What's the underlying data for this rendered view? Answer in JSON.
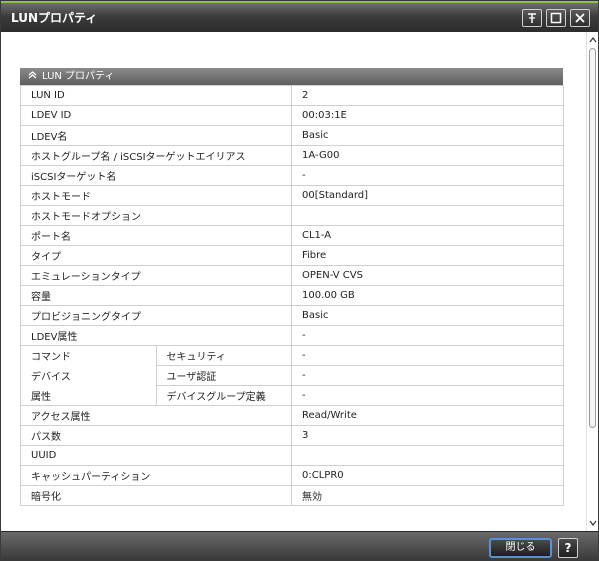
{
  "window": {
    "title": "LUNプロパティ"
  },
  "section": {
    "title": "LUN プロパティ"
  },
  "rows": [
    {
      "name": "LUN ID",
      "value": "2"
    },
    {
      "name": "LDEV ID",
      "value": "00:03:1E"
    },
    {
      "name": "LDEV名",
      "value": "Basic"
    },
    {
      "name": "ホストグループ名 / iSCSIターゲットエイリアス",
      "value": "1A-G00"
    },
    {
      "name": "iSCSIターゲット名",
      "value": "-"
    },
    {
      "name": "ホストモード",
      "value": "00[Standard]"
    },
    {
      "name": "ホストモードオプション",
      "value": ""
    },
    {
      "name": "ポート名",
      "value": "CL1-A"
    },
    {
      "name": "タイプ",
      "value": "Fibre"
    },
    {
      "name": "エミュレーションタイプ",
      "value": "OPEN-V CVS"
    },
    {
      "name": "容量",
      "value": "100.00 GB"
    },
    {
      "name": "プロビジョニングタイプ",
      "value": "Basic"
    },
    {
      "name": "LDEV属性",
      "value": "-"
    }
  ],
  "cmd_device": {
    "label_lines": [
      "コマンド",
      "デバイス",
      "属性"
    ],
    "rows": [
      {
        "name": "セキュリティ",
        "value": "-"
      },
      {
        "name": "ユーザ認証",
        "value": "-"
      },
      {
        "name": "デバイスグループ定義",
        "value": "-"
      }
    ]
  },
  "rows2": [
    {
      "name": "アクセス属性",
      "value": "Read/Write"
    },
    {
      "name": "パス数",
      "value": "3"
    },
    {
      "name": "UUID",
      "value": ""
    },
    {
      "name": "キャッシュパーティション",
      "value": "0:CLPR0"
    },
    {
      "name": "暗号化",
      "value": "無効"
    }
  ],
  "footer": {
    "close_label": "閉じる",
    "help_label": "?"
  },
  "icons": {
    "collapse": "chevron-up-double-icon",
    "pin": "pin-icon",
    "maximize": "maximize-icon",
    "close": "close-icon",
    "scroll_up": "scroll-up-icon",
    "scroll_down": "scroll-down-icon"
  },
  "colors": {
    "accent": "#8bc34a",
    "titlebar": "#3c3c3c",
    "header": "#707070",
    "primary_button_border": "#5b8fd6"
  }
}
